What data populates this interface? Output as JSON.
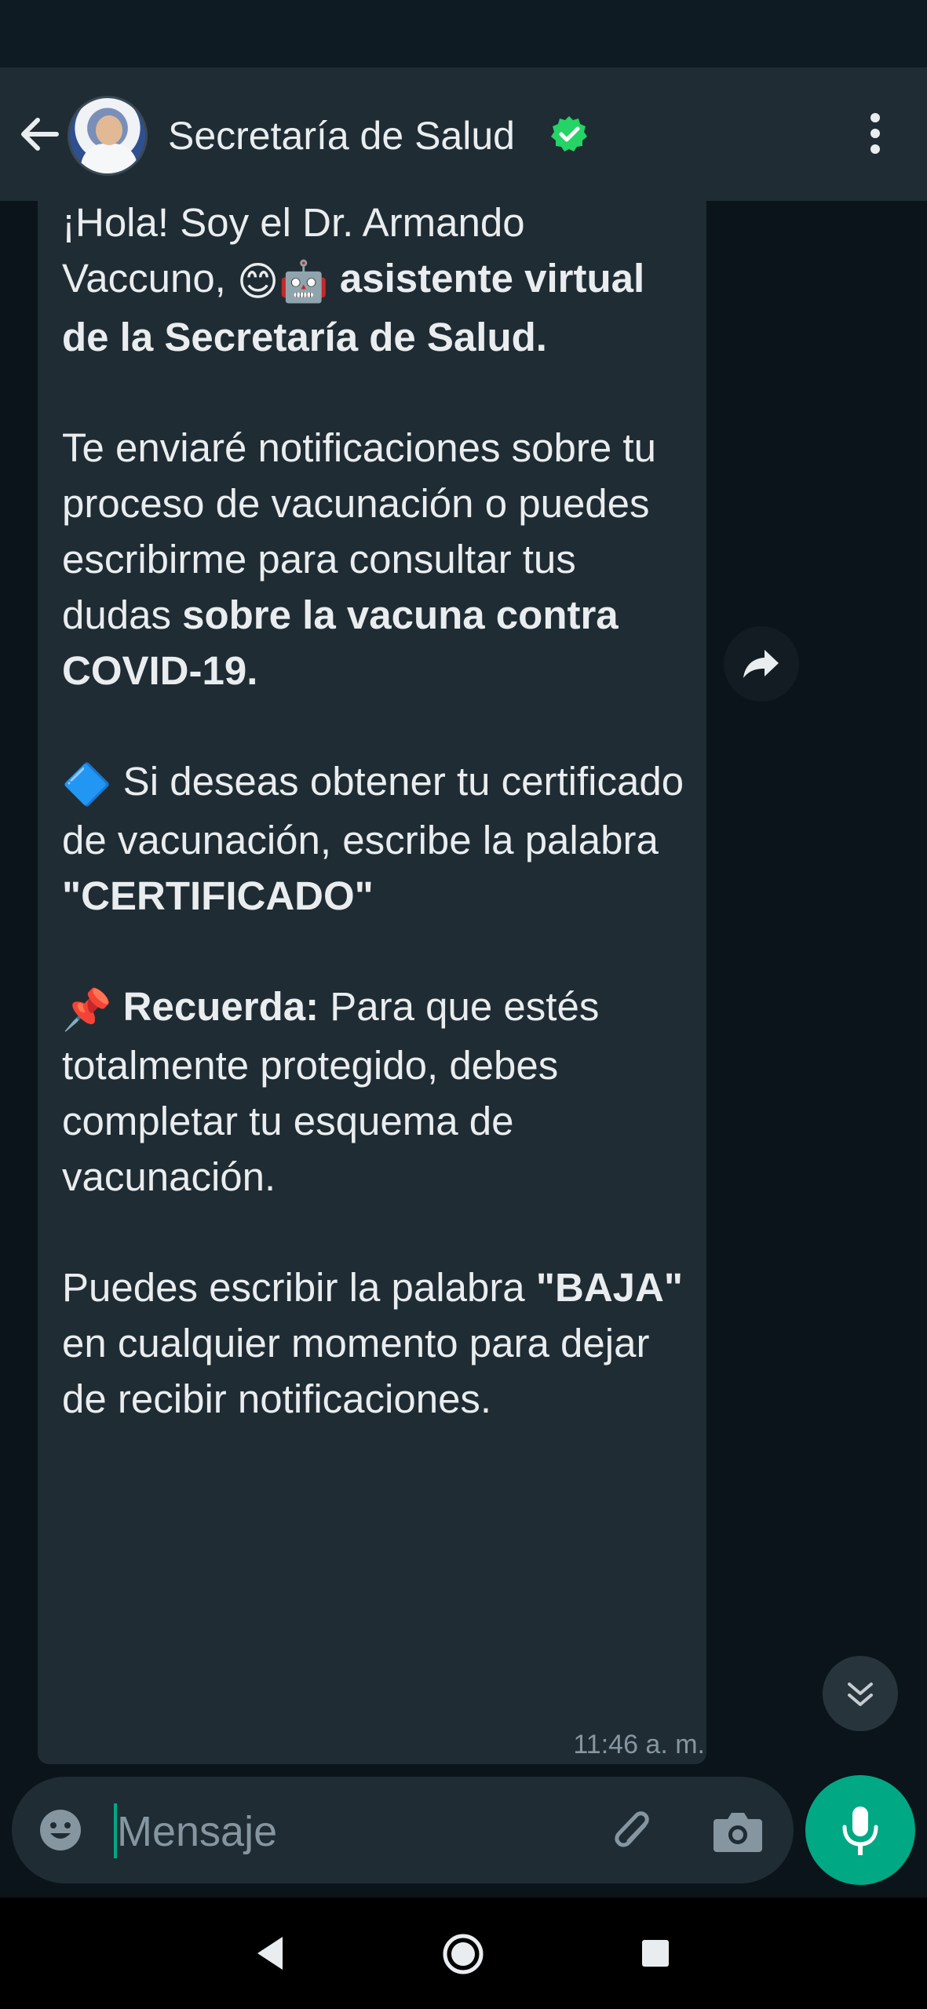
{
  "header": {
    "contact_name": "Secretaría de Salud",
    "verified": true
  },
  "message": {
    "intro_1": "¡Hola! Soy el Dr. Armando Vaccuno, ",
    "intro_emojis": "😊🤖",
    "intro_bold": " asistente virtual de la Secretaría de Salud.",
    "p2_text": "Te enviaré notificaciones sobre tu proceso de vacunación o puedes escribirme para consultar tus dudas ",
    "p2_bold": "sobre la vacuna contra COVID-19.",
    "p3_icon": "🔷",
    "p3_text": " Si deseas obtener tu certificado de vacunación, escribe la palabra ",
    "p3_bold": "\"CERTIFICADO\"",
    "p4_icon": "📌",
    "p4_bold": " Recuerda:",
    "p4_text": " Para que estés totalmente protegido, debes completar tu esquema de vacunación.",
    "p5_text_1": "Puedes escribir la palabra ",
    "p5_bold": "\"BAJA\"",
    "p5_text_2": " en cualquier momento para dejar de recibir notificaciones.",
    "time": "11:46 a. m."
  },
  "composer": {
    "placeholder": "Mensaje"
  },
  "colors": {
    "header_bg": "#1f2c34",
    "chat_bg": "#0b141a",
    "bubble_bg": "#202c33",
    "accent": "#00a884",
    "verified": "#25d366"
  }
}
